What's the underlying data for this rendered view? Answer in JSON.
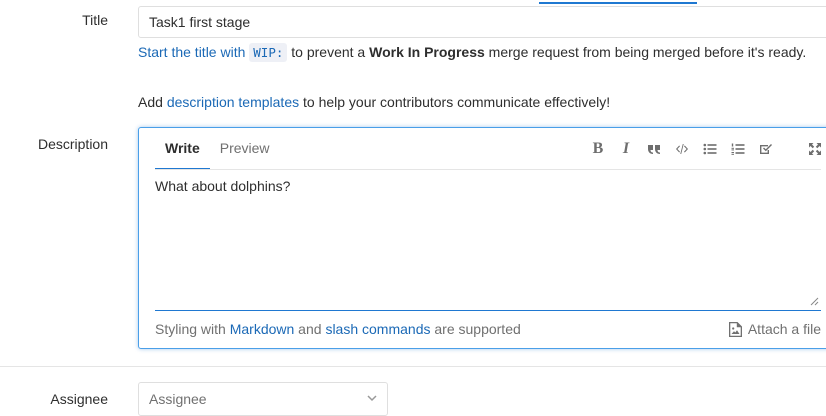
{
  "labels": {
    "title": "Title",
    "description": "Description",
    "assignee": "Assignee"
  },
  "title_field": {
    "value": "Task1 first stage"
  },
  "wip_help": {
    "link_text": "Start the title with",
    "code": "WIP:",
    "text1": " to prevent a ",
    "bold": "Work In Progress",
    "text2": " merge request from being merged before it's ready."
  },
  "templates_help": {
    "prefix": "Add ",
    "link_text": "description templates",
    "suffix": " to help your contributors communicate effectively!"
  },
  "editor": {
    "tabs": [
      {
        "label": "Write",
        "active": true
      },
      {
        "label": "Preview",
        "active": false
      }
    ],
    "toolbar": [
      "bold-icon",
      "italic-icon",
      "quote-icon",
      "code-icon",
      "bullet-list-icon",
      "numbered-list-icon",
      "task-list-icon"
    ],
    "fullscreen_icon": "fullscreen-icon",
    "content": "What about dolphins?",
    "footer": {
      "prefix": "Styling with ",
      "markdown_link": "Markdown",
      "middle": " and ",
      "slash_link": "slash commands",
      "suffix": " are supported"
    },
    "attach_label": "Attach a file"
  },
  "assignee": {
    "placeholder": "Assignee"
  },
  "colors": {
    "accent": "#1f78d1",
    "link": "#1b69b6"
  }
}
